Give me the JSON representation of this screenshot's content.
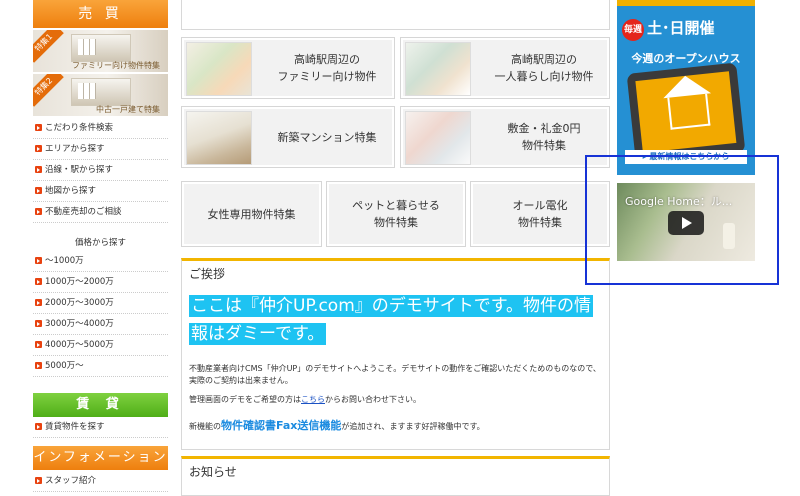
{
  "sidebar": {
    "buy_header": "売 買",
    "feature1": {
      "tag": "特集1",
      "caption": "ファミリー向け物件特集"
    },
    "feature2": {
      "tag": "特集2",
      "caption": "中古一戸建て特集"
    },
    "links": [
      "こだわり条件検索",
      "エリアから探す",
      "沿線・駅から探す",
      "地図から探す",
      "不動産売却のご相談"
    ],
    "price_heading": "価格から探す",
    "prices": [
      "～1000万",
      "1000万～2000万",
      "2000万～3000万",
      "3000万～4000万",
      "4000万～5000万",
      "5000万～"
    ],
    "rent_header": "賃 貸",
    "rent_link": "賃貸物件を探す",
    "info_header": "インフォメーション",
    "info_link": "スタッフ紹介"
  },
  "tiles": {
    "t1_line1": "高崎駅周辺の",
    "t1_line2": "ファミリー向け物件",
    "t2_line1": "高崎駅周辺の",
    "t2_line2": "一人暮らし向け物件",
    "t3": "新築マンション特集",
    "t4_line1": "敷金・礼金0円",
    "t4_line2": "物件特集",
    "t5": "女性専用物件特集",
    "t6_line1": "ペットと暮らせる",
    "t6_line2": "物件特集",
    "t7_line1": "オール電化",
    "t7_line2": "物件特集"
  },
  "greeting": {
    "title": "ご挨拶",
    "headline": "ここは『仲介UP.com』のデモサイトです。物件の情報はダミーです。",
    "para1": "不動産業者向けCMS「仲介UP」のデモサイトへようこそ。デモサイトの動作をご確認いただくためのものなので、実際のご契約は出来ません。",
    "para2_pre": "管理画面のデモをご希望の方は",
    "para2_link": "こちら",
    "para2_post": "からお問い合わせ下さい。",
    "para3_pre": "新機能の",
    "para3_emph": "物件確認書Fax送信機能",
    "para3_post": "が追加され、ますます好評稼働中です。"
  },
  "news": {
    "title": "お知らせ"
  },
  "openhouse": {
    "badge": "毎週",
    "date": "土･日開催",
    "sub": "今週のオープンハウス",
    "link": "▸ 最新情報はこちらから"
  },
  "video": {
    "title": "Google Home：ル..."
  }
}
